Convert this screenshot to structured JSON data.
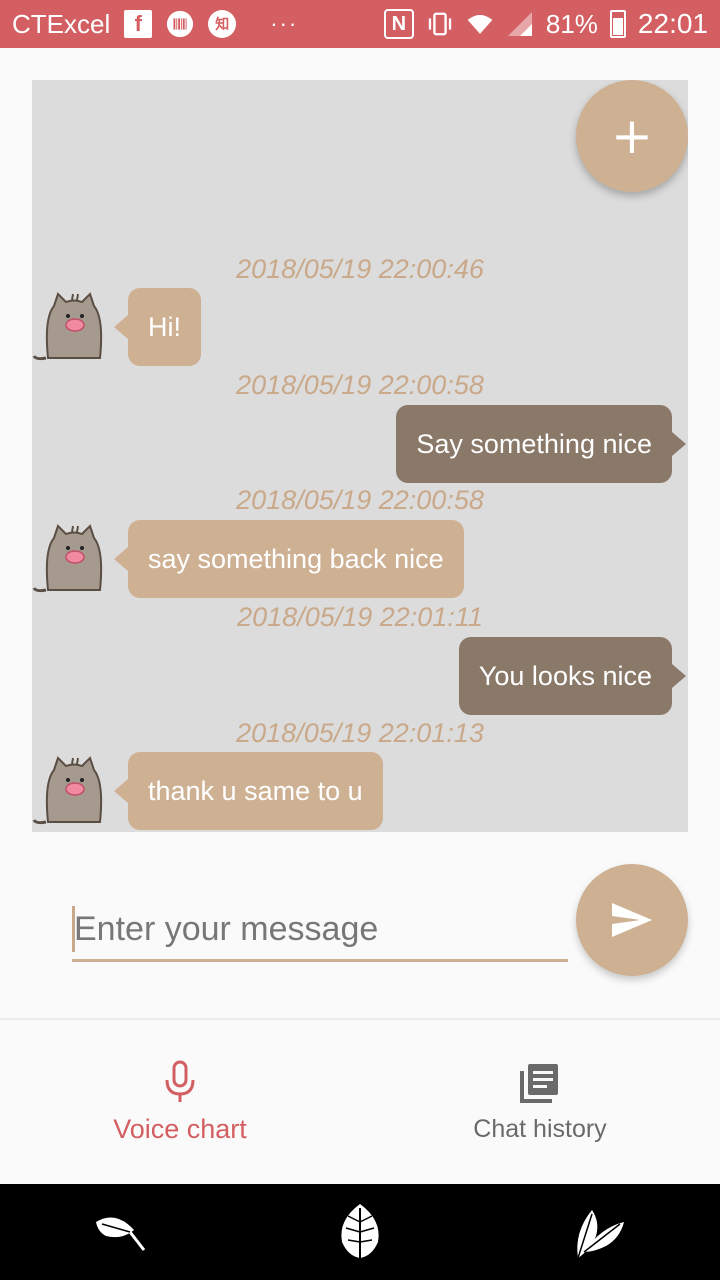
{
  "status_bar": {
    "app_name": "CTExcel",
    "fb_glyph": "f",
    "zhi_glyph": "知",
    "dots": "···",
    "nfc_glyph": "N",
    "battery": "81%",
    "time": "22:01"
  },
  "chat": {
    "messages": [
      {
        "timestamp": "2018/05/19 22:00:46",
        "text": "Hi!",
        "direction": "in"
      },
      {
        "timestamp": "2018/05/19 22:00:58",
        "text": "Say something nice",
        "direction": "out"
      },
      {
        "timestamp": "2018/05/19 22:00:58",
        "text": "say something back nice",
        "direction": "in"
      },
      {
        "timestamp": "2018/05/19 22:01:11",
        "text": "You looks nice",
        "direction": "out"
      },
      {
        "timestamp": "2018/05/19 22:01:13",
        "text": "thank u same to u",
        "direction": "in"
      }
    ],
    "add_icon": "+"
  },
  "input": {
    "placeholder": "Enter your message",
    "value": ""
  },
  "tabs": [
    {
      "label": "Voice chart",
      "icon": "mic-icon",
      "active": true
    },
    {
      "label": "Chat history",
      "icon": "history-icon",
      "active": false
    }
  ],
  "colors": {
    "accent": "#d35f63",
    "bubble_in": "#ceb093",
    "bubble_out": "#8a7868",
    "timestamp": "#c9a98a",
    "chat_bg": "#dcdcdc"
  }
}
